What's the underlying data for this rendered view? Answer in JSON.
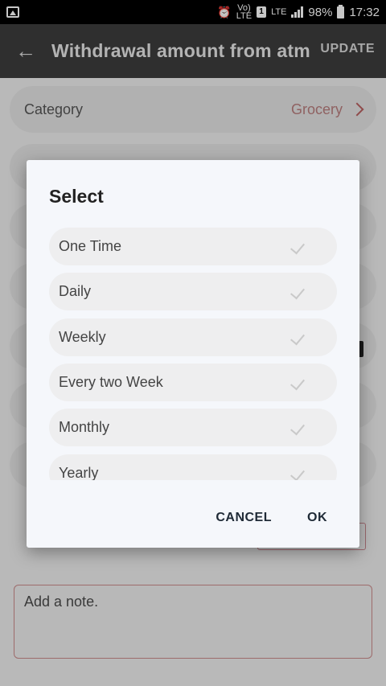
{
  "status_bar": {
    "battery": "98%",
    "time": "17:32",
    "volte_top": "Vo)",
    "volte_bottom": "LTE",
    "sim": "1",
    "lte": "LTE"
  },
  "app_bar": {
    "title": "Withdrawal amount from atm",
    "update_label": "UPDATE"
  },
  "form": {
    "category_label": "Category",
    "category_value": "Grocery",
    "note_placeholder": "Add a note."
  },
  "dialog": {
    "title": "Select",
    "options": [
      "One Time",
      "Daily",
      "Weekly",
      "Every two Week",
      "Monthly",
      "Yearly"
    ],
    "cancel_label": "CANCEL",
    "ok_label": "OK"
  }
}
